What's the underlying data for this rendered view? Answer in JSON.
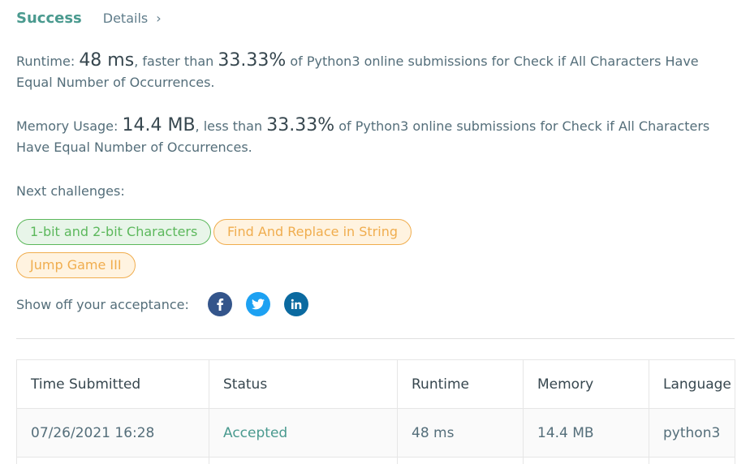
{
  "header": {
    "status": "Success",
    "details_label": "Details",
    "chevron": "›"
  },
  "runtime_stat": {
    "label": "Runtime: ",
    "value": "48 ms",
    "middle": ", faster than ",
    "percent": "33.33%",
    "suffix": " of Python3 online submissions for Check if All Characters Have Equal Number of Occurrences."
  },
  "memory_stat": {
    "label": "Memory Usage: ",
    "value": "14.4 MB",
    "middle": ", less than ",
    "percent": "33.33%",
    "suffix": " of Python3 online submissions for Check if All Characters Have Equal Number of Occurrences."
  },
  "next_challenges": {
    "label": "Next challenges:",
    "items": [
      {
        "label": "1-bit and 2-bit Characters",
        "difficulty": "easy"
      },
      {
        "label": "Find And Replace in String",
        "difficulty": "medium"
      },
      {
        "label": "Jump Game III",
        "difficulty": "medium"
      }
    ]
  },
  "share": {
    "label": "Show off your acceptance:",
    "icons": [
      {
        "name": "facebook-icon",
        "color": "#3b5998",
        "glyph": "f"
      },
      {
        "name": "twitter-icon",
        "color": "#1da1f2",
        "glyph": "t"
      },
      {
        "name": "linkedin-icon",
        "color": "#0e76a8",
        "glyph": "in"
      }
    ]
  },
  "table": {
    "headers": [
      "Time Submitted",
      "Status",
      "Runtime",
      "Memory",
      "Language"
    ],
    "rows": [
      [
        "07/26/2021 16:28",
        "Accepted",
        "48 ms",
        "14.4 MB",
        "python3"
      ]
    ]
  },
  "colors": {
    "success": "#4a9a8f",
    "easy": "#5cb85c",
    "medium": "#f0ad4e"
  }
}
